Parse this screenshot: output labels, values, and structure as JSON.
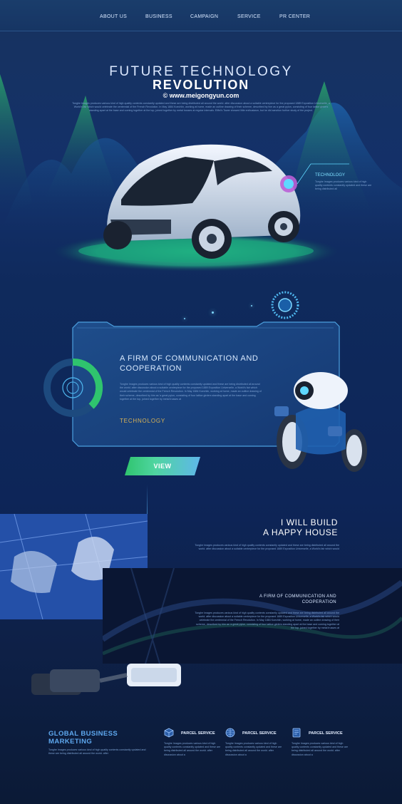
{
  "nav": {
    "items": [
      "ABOUT US",
      "BUSINESS",
      "CAMPAIGN",
      "SERVICE",
      "PR CENTER"
    ]
  },
  "hero": {
    "title_line1": "FUTURE TECHNOLOGY",
    "title_line2": "REVOLUTION",
    "watermark": "© www.meigongyun.com",
    "description": "Tonghe Images produces various kind of high quality contents constantly updated and these are being distributed all around the world. after discussion about a suitable centrepiece for the proposed 1889 Exposition Universelle, a World's fair which would celebrate the centennial of the French Revolution. In May 1884 Koechlin, working at home, made an outline drawing of their scheme, described by him as a great pylon, consisting of four lattice girders standing apart at the base and coming together at the top, joined together by metal trusses at regular intervals. Eiffel's Tower showed little enthusiasm, but he did sanction further study of the project."
  },
  "callout": {
    "title": "TECHNOLOGY",
    "description": "Tonghe Images produces various kind of high quality contents constantly updated and these are being distributed all"
  },
  "panel": {
    "title": "A FIRM OF COMMUNICATION AND COOPERATION",
    "description": "Tonghe Images produces various kind of high quality contents constantly updated and these are being distributed all around the world. after discussion about a suitable centrepiece for the proposed 1889 Exposition Universelle, a World's fair which would celebrate the centennial of the French Revolution. In May 1884 Koechlin, working at home, made an outline drawing of their scheme, described by him as 'a great pylon, consisting of four lattice girders standing apart at the base and coming together at the top, joined together by metal trusses at",
    "tag": "TECHNOLOGY",
    "button_label": "VIEW"
  },
  "house": {
    "title_line1": "I WILL BUILD",
    "title_line2": "A HAPPY HOUSE",
    "description": "Tonghe Images produces various kind of high quality contents constantly updated and these are being distributed all around the world. after discussion about a suitable centrepiece for the proposed 1889 Exposition Universelle, a World's fair which would"
  },
  "dark_block": {
    "title_line1": "A FIRM OF COMMUNICATION AND",
    "title_line2": "COOPERATION",
    "description": "Tonghe Images produces various kind of high quality contents constantly updated and these are being distributed all around the world. after discussion about a suitable centrepiece for the proposed 1889 Exposition Universelle, a World's fair which would celebrate the centennial of the French Revolution. In May 1884 Koechlin, working at home, made an outline drawing of their scheme, described by him as 'a great pylon, consisting of four lattice girders standing apart at the base and coming together at the top, joined together by metal trusses at"
  },
  "bottom": {
    "global_line1": "GLOBAL BUSINESS",
    "global_line2": "MARKETING",
    "global_desc": "Tonghe Images produces various kind of high quality contents constantly updated and these are being distributed all around the world. after",
    "services": [
      {
        "icon": "box-icon",
        "label": "PARCEL SERVICE",
        "desc": "Tonghe Images produces various kind of high quality contents constantly updated and these are being distributed all around the world. after discussion about a"
      },
      {
        "icon": "globe-icon",
        "label": "PARCEL SERVICE",
        "desc": "Tonghe Images produces various kind of high quality contents constantly updated and these are being distributed all around the world. after discussion about a"
      },
      {
        "icon": "document-icon",
        "label": "PARCEL SERVICE",
        "desc": "Tonghe Images produces various kind of high quality contents constantly updated and these are being distributed all around the world. after discussion about a"
      }
    ]
  },
  "colors": {
    "accent_green": "#2fc46e",
    "accent_cyan": "#5fd8ff",
    "accent_gold": "#d9b356",
    "background": "#0d1d3d"
  }
}
